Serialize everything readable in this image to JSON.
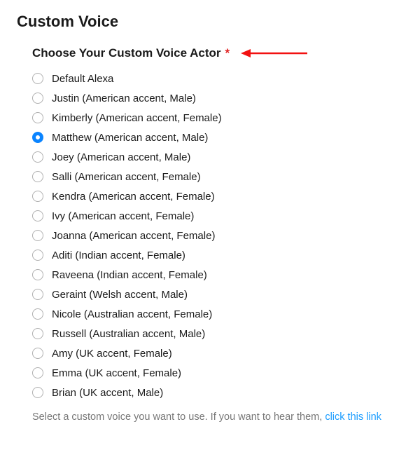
{
  "page_title": "Custom Voice",
  "section_title": "Choose Your Custom Voice Actor",
  "required_marker": "*",
  "selected_index": 3,
  "voices": [
    {
      "label": "Default Alexa"
    },
    {
      "label": "Justin (American accent, Male)"
    },
    {
      "label": "Kimberly (American accent, Female)"
    },
    {
      "label": "Matthew (American accent, Male)"
    },
    {
      "label": "Joey (American accent, Male)"
    },
    {
      "label": "Salli (American accent, Female)"
    },
    {
      "label": "Kendra (American accent, Female)"
    },
    {
      "label": "Ivy (American accent, Female)"
    },
    {
      "label": "Joanna (American accent, Female)"
    },
    {
      "label": "Aditi (Indian accent, Female)"
    },
    {
      "label": "Raveena (Indian accent, Female)"
    },
    {
      "label": "Geraint (Welsh accent, Male)"
    },
    {
      "label": "Nicole (Australian accent, Female)"
    },
    {
      "label": "Russell (Australian accent, Male)"
    },
    {
      "label": "Amy (UK accent, Female)"
    },
    {
      "label": "Emma (UK accent, Female)"
    },
    {
      "label": "Brian (UK accent, Male)"
    }
  ],
  "hint": {
    "prefix": "Select a custom voice you want to use. If you want to hear them, ",
    "link_text": "click this link"
  },
  "colors": {
    "accent": "#0a84ff",
    "required": "#e02020",
    "link": "#1a9cff",
    "arrow": "#f21111"
  }
}
